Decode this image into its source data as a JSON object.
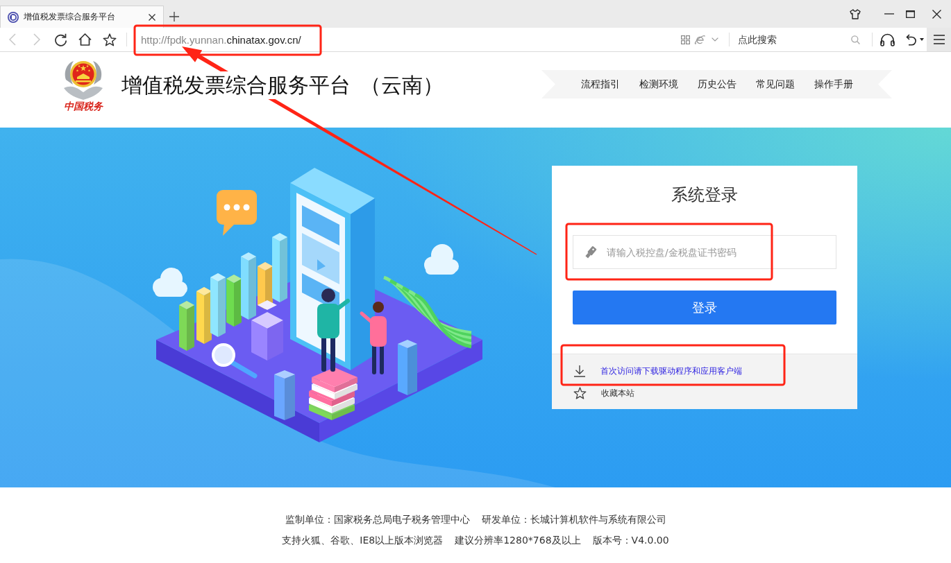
{
  "browser": {
    "tab": {
      "title": "增值税发票综合服务平台",
      "selected": true
    },
    "toolbar": [
      {
        "kind": "back",
        "disabled": true
      },
      {
        "kind": "forward",
        "disabled": true
      },
      {
        "kind": "reload",
        "disabled": false
      },
      {
        "kind": "home",
        "disabled": false
      },
      {
        "kind": "bookmark",
        "disabled": false
      }
    ],
    "address": {
      "subdomain": "http://fpdk.yunnan.",
      "domain": "chinatax.gov.cn/"
    },
    "search": {
      "placeholder": "点此搜索"
    }
  },
  "header": {
    "logo_text": "中国税务",
    "title": "增值税发票综合服务平台",
    "region": "（云南）",
    "nav": [
      "流程指引",
      "检测环境",
      "历史公告",
      "常见问题",
      "操作手册"
    ]
  },
  "login": {
    "title": "系统登录",
    "password": {
      "placeholder": "请输入税控盘/金税盘证书密码"
    },
    "submit": "登录",
    "links": [
      {
        "kind": "download",
        "label": "首次访问请下载驱动程序和应用客户端"
      },
      {
        "kind": "bookmark",
        "label": "收藏本站"
      }
    ]
  },
  "footer": {
    "lines": [
      [
        "监制单位：国家税务总局电子税务管理中心",
        "研发单位：长城计算机软件与系统有限公司"
      ],
      [
        "支持火狐、谷歌、IE8以上版本浏览器",
        "建议分辨率1280*768及以上",
        "版本号：V4.0.00"
      ]
    ]
  },
  "annotations": [
    {
      "kind": "box"
    },
    {
      "kind": "box"
    },
    {
      "kind": "box"
    },
    {
      "kind": "arrow"
    }
  ]
}
